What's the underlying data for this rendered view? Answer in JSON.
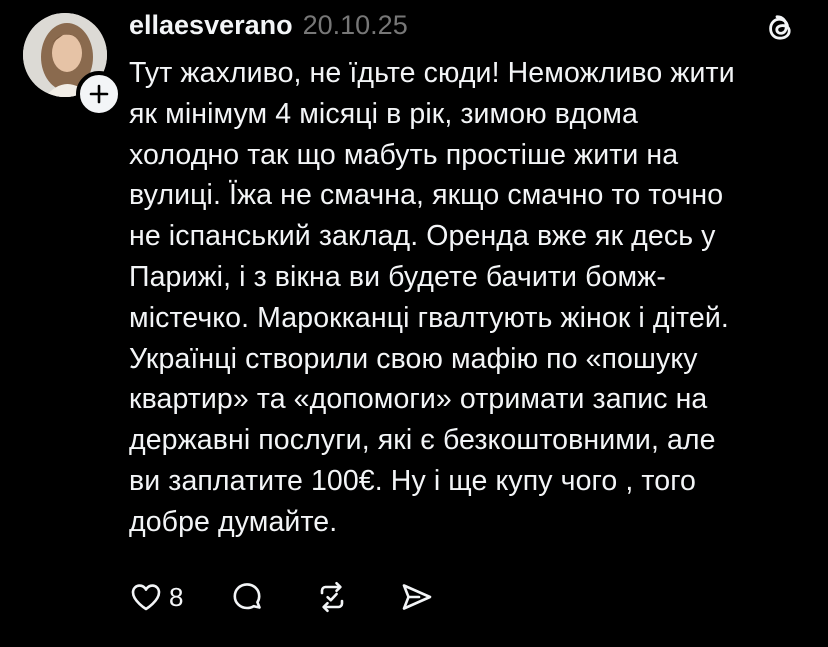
{
  "post": {
    "username": "ellaesverano",
    "timestamp": "20.10.25",
    "text": "Тут жахливо, не їдьте сюди! Неможливо жити\nяк мінімум 4 місяці в рік, зимою вдома\nхолодно так що мабуть простіше жити на\nвулиці. Їжа не смачна, якщо смачно то точно\nне іспанський заклад. Оренда вже як десь у\nПарижі, і з вікна ви будете бачити бомж-\nмістечко. Марокканці гвалтують жінок і дітей.\nУкраїнці створили свою мафію по «пошуку\nквартир» та «допомоги» отримати запис на\nдержавні послуги, які є безкоштовними, але\nви заплатите 100€. Ну і ще купу чого , того\nдобре думайте.",
    "like_count": "8"
  },
  "icons": {
    "follow": "plus-icon",
    "brand": "threads-logo-icon",
    "like": "heart-icon",
    "reply": "comment-bubble-icon",
    "repost": "repost-icon",
    "share": "send-icon"
  },
  "colors": {
    "background": "#000000",
    "text": "#f3f5f7",
    "secondary_text": "#777777"
  }
}
